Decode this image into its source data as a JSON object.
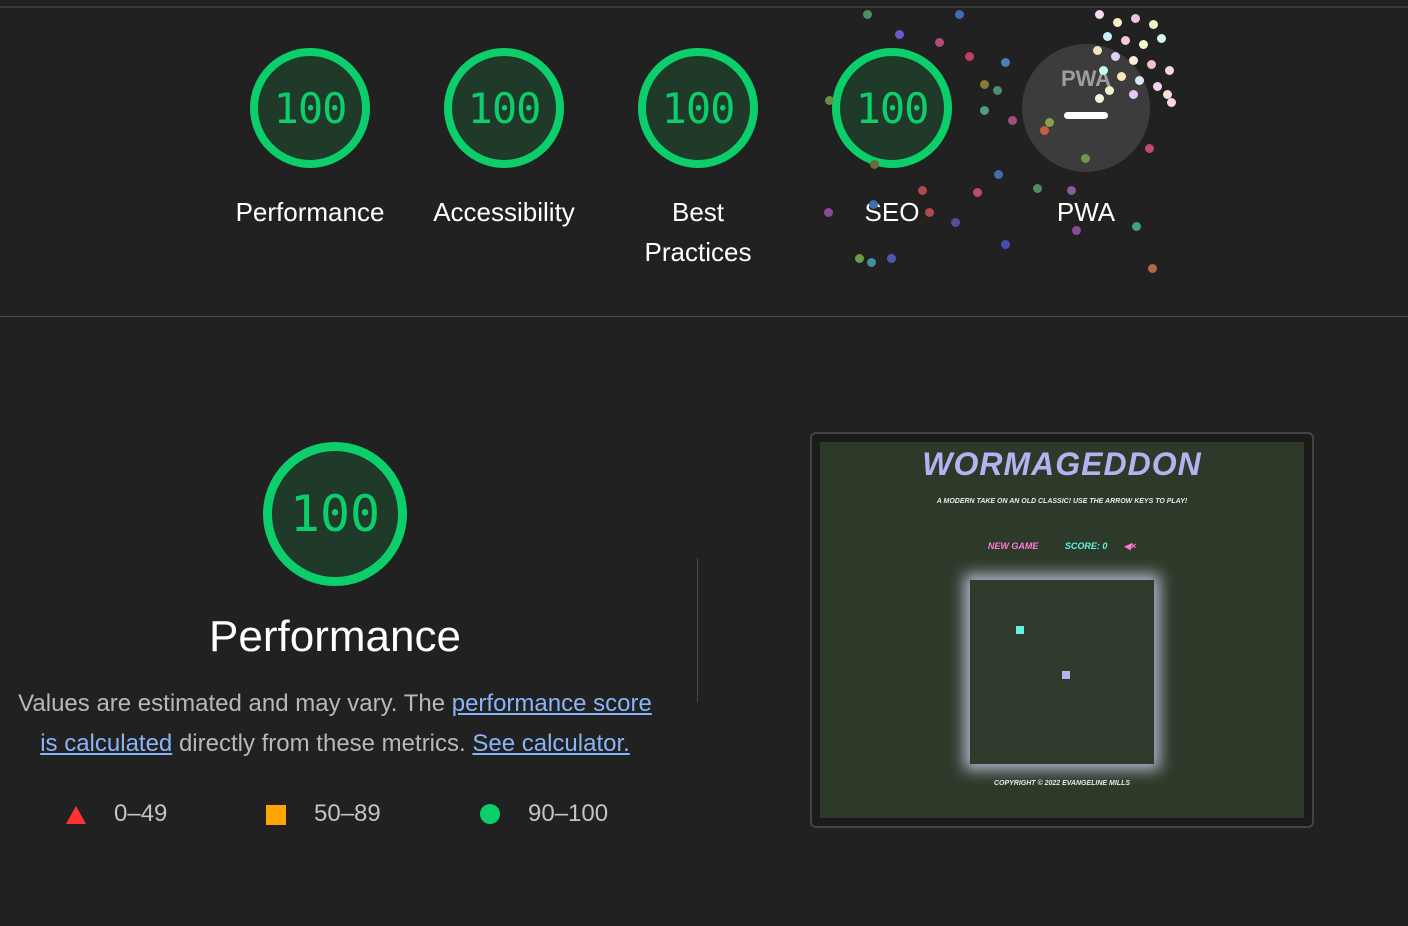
{
  "gauges": [
    {
      "score": "100",
      "label": "Performance"
    },
    {
      "score": "100",
      "label": "Accessibility"
    },
    {
      "score": "100",
      "label": "Best Practices"
    },
    {
      "score": "100",
      "label": "SEO"
    }
  ],
  "pwa": {
    "badge_text": "PWA",
    "label": "PWA"
  },
  "performance": {
    "score": "100",
    "title": "Performance",
    "desc_prefix": "Values are estimated and may vary. The ",
    "link_score": "performance score is calculated",
    "desc_middle": " directly from these metrics. ",
    "link_calculator": "See calculator."
  },
  "legend": [
    {
      "range": "0–49",
      "color": "#ff3333"
    },
    {
      "range": "50–89",
      "color": "#ffa400"
    },
    {
      "range": "90–100",
      "color": "#0cce6b"
    }
  ],
  "screenshot": {
    "title": "WORMAGEDDON",
    "subtitle": "A MODERN TAKE ON AN OLD CLASSIC! USE THE ARROW KEYS TO PLAY!",
    "new_game": "NEW GAME",
    "score": "SCORE: 0",
    "mute_icon": "speaker-muted-icon",
    "footer": "COPYRIGHT © 2022 EVANGELINE MILLS"
  },
  "colors": {
    "pass": "#0cce6b",
    "average": "#ffa400",
    "fail": "#ff3333",
    "link": "#8ab4f8"
  }
}
